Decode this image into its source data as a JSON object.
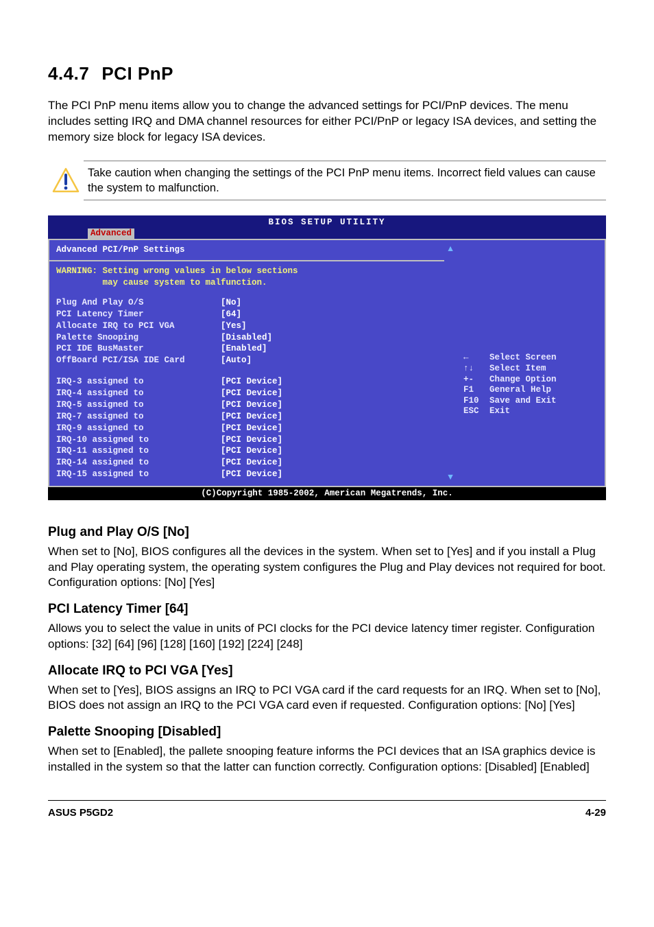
{
  "section": {
    "number": "4.4.7",
    "title": "PCI PnP",
    "intro": "The PCI PnP menu items allow you to change the advanced settings for PCI/PnP devices. The menu includes setting IRQ and DMA channel resources for either PCI/PnP or legacy ISA devices, and setting the memory size block for legacy ISA devices."
  },
  "caution": {
    "text": "Take caution when changing the settings of the PCI PnP menu items. Incorrect field values can cause the system to malfunction."
  },
  "bios": {
    "header": "BIOS SETUP UTILITY",
    "active_tab": "Advanced",
    "subtitle": "Advanced PCI/PnP Settings",
    "warning_line1": "WARNING: Setting wrong values in below sections",
    "warning_line2": "         may cause system to malfunction.",
    "settings": [
      {
        "label": "Plug And Play O/S",
        "value": "[No]"
      },
      {
        "label": "PCI Latency Timer",
        "value": "[64]"
      },
      {
        "label": "Allocate IRQ to PCI VGA",
        "value": "[Yes]"
      },
      {
        "label": "Palette Snooping",
        "value": "[Disabled]"
      },
      {
        "label": "PCI IDE BusMaster",
        "value": "[Enabled]"
      },
      {
        "label": "OffBoard PCI/ISA IDE Card",
        "value": "[Auto]"
      }
    ],
    "irq": [
      {
        "label": "IRQ-3 assigned to",
        "value": "[PCI Device]"
      },
      {
        "label": "IRQ-4 assigned to",
        "value": "[PCI Device]"
      },
      {
        "label": "IRQ-5 assigned to",
        "value": "[PCI Device]"
      },
      {
        "label": "IRQ-7 assigned to",
        "value": "[PCI Device]"
      },
      {
        "label": "IRQ-9 assigned to",
        "value": "[PCI Device]"
      },
      {
        "label": "IRQ-10 assigned to",
        "value": "[PCI Device]"
      },
      {
        "label": "IRQ-11 assigned to",
        "value": "[PCI Device]"
      },
      {
        "label": "IRQ-14 assigned to",
        "value": "[PCI Device]"
      },
      {
        "label": "IRQ-15 assigned to",
        "value": "[PCI Device]"
      }
    ],
    "help": [
      {
        "key": "←",
        "desc": "Select Screen"
      },
      {
        "key": "↑↓",
        "desc": "Select Item"
      },
      {
        "key": "+-",
        "desc": "Change Option"
      },
      {
        "key": "F1",
        "desc": "General Help"
      },
      {
        "key": "F10",
        "desc": "Save and Exit"
      },
      {
        "key": "ESC",
        "desc": "Exit"
      }
    ],
    "footer": "(C)Copyright 1985-2002, American Megatrends, Inc."
  },
  "descriptions": [
    {
      "heading": "Plug and Play O/S [No]",
      "body": "When set to [No], BIOS configures all the devices in the system. When set to [Yes] and if you install a Plug and Play operating system, the operating system configures the Plug and Play devices not required for boot. Configuration options: [No] [Yes]"
    },
    {
      "heading": "PCI Latency Timer [64]",
      "body": "Allows you to select the value in units of PCI clocks for the PCI device latency timer register. Configuration options: [32] [64] [96] [128] [160] [192] [224] [248]"
    },
    {
      "heading": "Allocate IRQ to PCI VGA [Yes]",
      "body": "When set to [Yes], BIOS assigns an IRQ to PCI VGA card if the card requests for an IRQ. When set to [No], BIOS does not assign an IRQ to the PCI VGA card even if requested. Configuration options: [No] [Yes]"
    },
    {
      "heading": "Palette Snooping [Disabled]",
      "body": "When set to [Enabled], the pallete snooping feature informs the PCI devices that an ISA graphics device is installed in the system so that the latter can function correctly. Configuration options: [Disabled] [Enabled]"
    }
  ],
  "footer": {
    "left": "ASUS P5GD2",
    "right": "4-29"
  }
}
